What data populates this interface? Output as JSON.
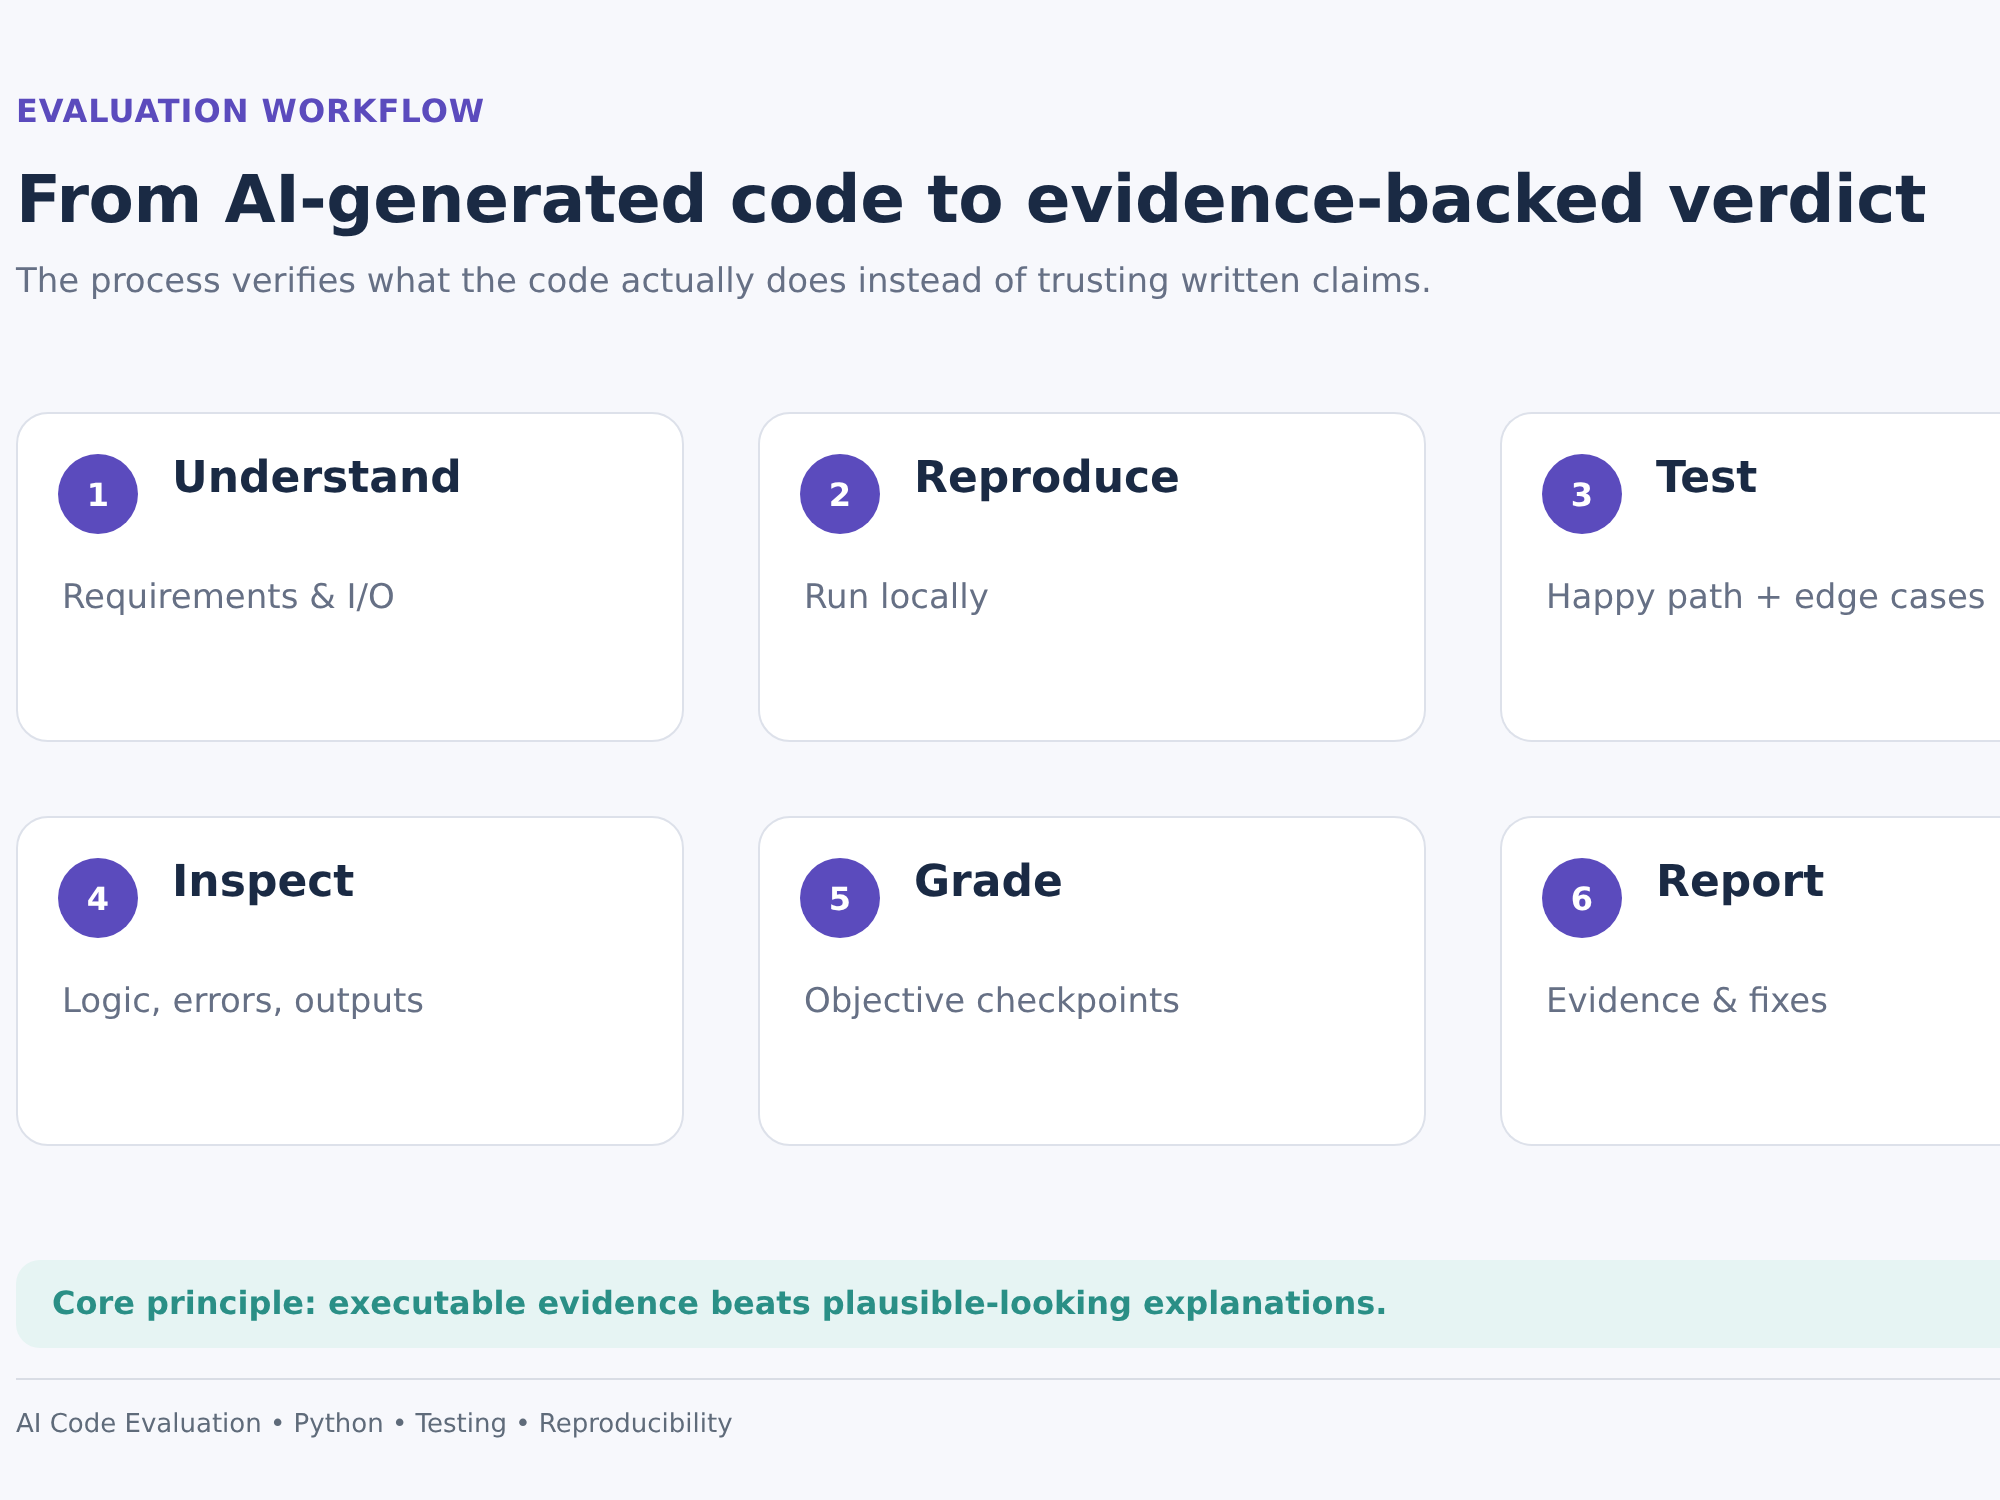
{
  "eyebrow": "EVALUATION WORKFLOW",
  "title": "From AI-generated code to evidence-backed verdict",
  "subtitle": "The process verifies what the code actually does instead of trusting written claims.",
  "steps": [
    {
      "number": "1",
      "title": "Understand",
      "description": "Requirements & I/O"
    },
    {
      "number": "2",
      "title": "Reproduce",
      "description": "Run locally"
    },
    {
      "number": "3",
      "title": "Test",
      "description": "Happy path + edge cases"
    },
    {
      "number": "4",
      "title": "Inspect",
      "description": "Logic, errors, outputs"
    },
    {
      "number": "5",
      "title": "Grade",
      "description": "Objective checkpoints"
    },
    {
      "number": "6",
      "title": "Report",
      "description": "Evidence & fixes"
    }
  ],
  "principle": "Core principle: executable evidence beats plausible-looking explanations.",
  "footer": "AI Code Evaluation • Python • Testing • Reproducibility"
}
